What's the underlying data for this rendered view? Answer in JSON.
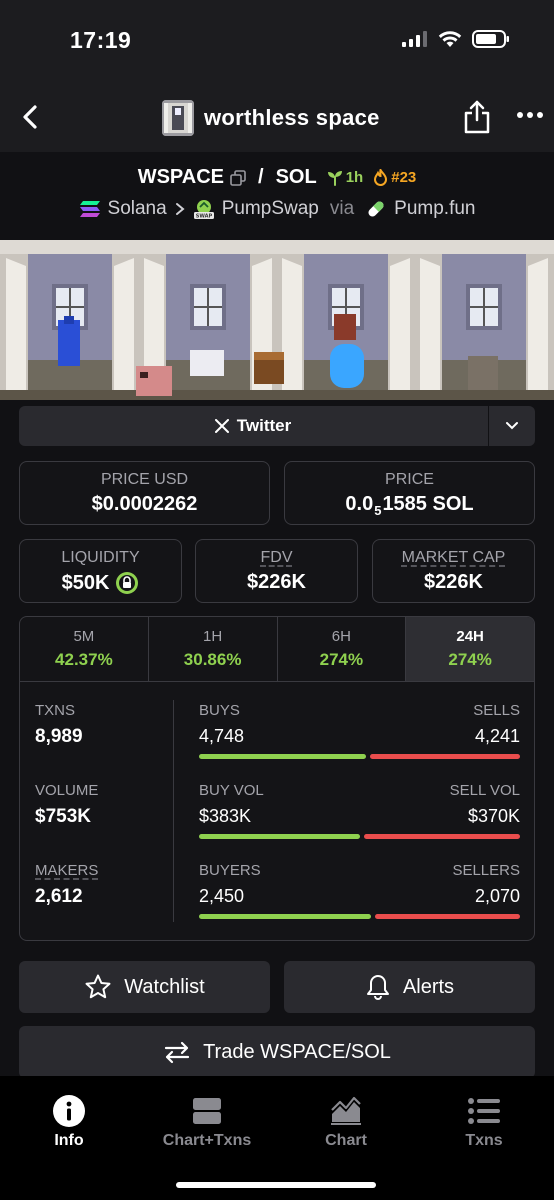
{
  "status": {
    "time": "17:19"
  },
  "nav": {
    "title": "worthless space"
  },
  "pair": {
    "base": "WSPACE",
    "quote": "SOL",
    "separator": "/",
    "age": "1h",
    "rank": "#23",
    "chain": "Solana",
    "dex": "PumpSwap",
    "via_label": "via",
    "launchpad": "Pump.fun"
  },
  "socials": {
    "twitter_label": "Twitter"
  },
  "price": {
    "usd_label": "PRICE USD",
    "usd_value": "$0.0002262",
    "native_label": "PRICE",
    "native_prefix": "0.0",
    "native_zeros": "5",
    "native_suffix": "1585 SOL"
  },
  "metrics": {
    "liquidity_label": "LIQUIDITY",
    "liquidity_value": "$50K",
    "fdv_label": "FDV",
    "fdv_value": "$226K",
    "mcap_label": "MARKET CAP",
    "mcap_value": "$226K"
  },
  "timeframes": [
    {
      "label": "5M",
      "change": "42.37%"
    },
    {
      "label": "1H",
      "change": "30.86%"
    },
    {
      "label": "6H",
      "change": "274%"
    },
    {
      "label": "24H",
      "change": "274%"
    }
  ],
  "stats": {
    "txns_label": "TXNS",
    "txns_value": "8,989",
    "volume_label": "VOLUME",
    "volume_value": "$753K",
    "makers_label": "MAKERS",
    "makers_value": "2,612",
    "buys_label": "BUYS",
    "buys_value": "4,748",
    "buys_share": 0.528,
    "sells_label": "SELLS",
    "sells_value": "4,241",
    "buyvol_label": "BUY VOL",
    "buyvol_value": "$383K",
    "buyvol_share": 0.509,
    "sellvol_label": "SELL VOL",
    "sellvol_value": "$370K",
    "buyers_label": "BUYERS",
    "buyers_value": "2,450",
    "buyers_share": 0.542,
    "sellers_label": "SELLERS",
    "sellers_value": "2,070"
  },
  "actions": {
    "watchlist_label": "Watchlist",
    "alerts_label": "Alerts",
    "trade_label": "Trade WSPACE/SOL"
  },
  "tabbar": {
    "info_label": "Info",
    "chart_txns_label": "Chart+Txns",
    "chart_label": "Chart",
    "txns_label": "Txns"
  },
  "colors": {
    "positive": "#8fd14f",
    "negative": "#ea4d4d",
    "rank": "#f5a623"
  }
}
